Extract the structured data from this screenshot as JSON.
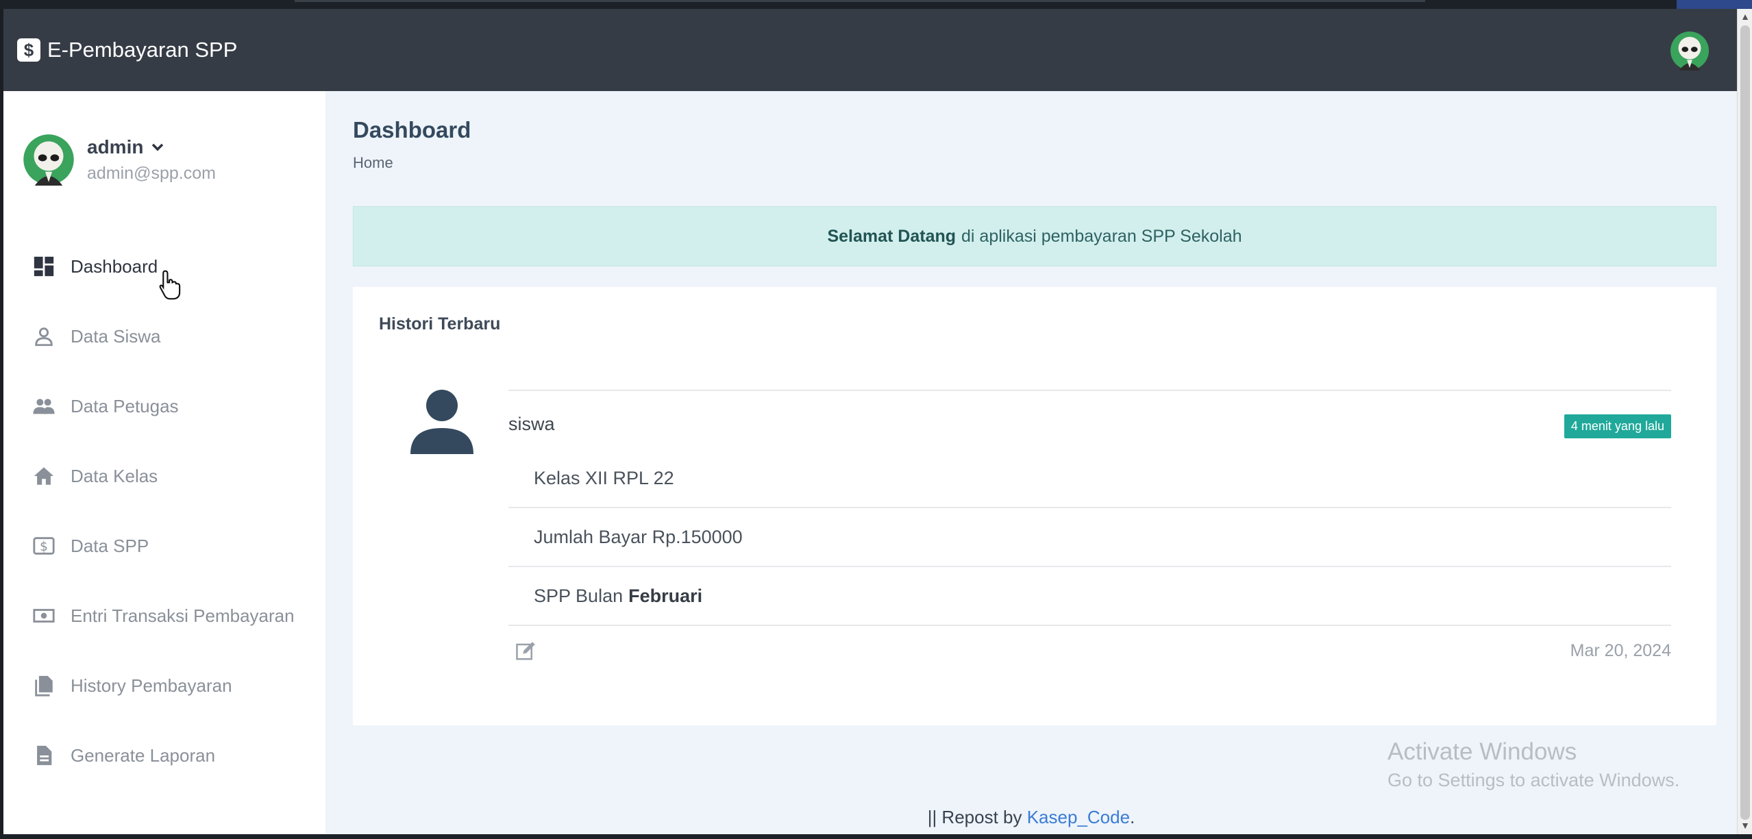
{
  "navbar": {
    "brand_icon": "$",
    "brand_text": "E-Pembayaran SPP",
    "avatar_icon": "user-avatar-icon"
  },
  "sidebar": {
    "user": {
      "name": "admin",
      "email": "admin@spp.com"
    },
    "items": [
      {
        "label": "Dashboard",
        "icon": "dashboard-icon",
        "active": true
      },
      {
        "label": "Data Siswa",
        "icon": "person-icon"
      },
      {
        "label": "Data Petugas",
        "icon": "people-icon"
      },
      {
        "label": "Data Kelas",
        "icon": "home-icon"
      },
      {
        "label": "Data SPP",
        "icon": "dollar-icon"
      },
      {
        "label": "Entri Transaksi Pembayaran",
        "icon": "money-icon"
      },
      {
        "label": "History Pembayaran",
        "icon": "documents-icon"
      },
      {
        "label": "Generate Laporan",
        "icon": "file-icon"
      }
    ]
  },
  "main": {
    "title": "Dashboard",
    "breadcrumb": "Home",
    "alert": {
      "bold": "Selamat Datang",
      "text": "di aplikasi pembayaran SPP Sekolah"
    },
    "history": {
      "title": "Histori Terbaru",
      "user": "siswa",
      "badge": "4 menit yang lalu",
      "kelas": "Kelas XII RPL 22",
      "jumlah": "Jumlah Bayar Rp.150000",
      "bulan_prefix": "SPP Bulan",
      "bulan": "Februari",
      "date": "Mar 20, 2024"
    }
  },
  "footer": {
    "prefix": "|| Repost by",
    "link": "Kasep_Code",
    "suffix": "."
  },
  "watermark": {
    "line1": "Activate Windows",
    "line2": "Go to Settings to activate Windows."
  },
  "colors": {
    "navbar": "#363c46",
    "badge": "#20a99a",
    "alert_bg": "#d2efee",
    "link": "#3b7bd6"
  }
}
